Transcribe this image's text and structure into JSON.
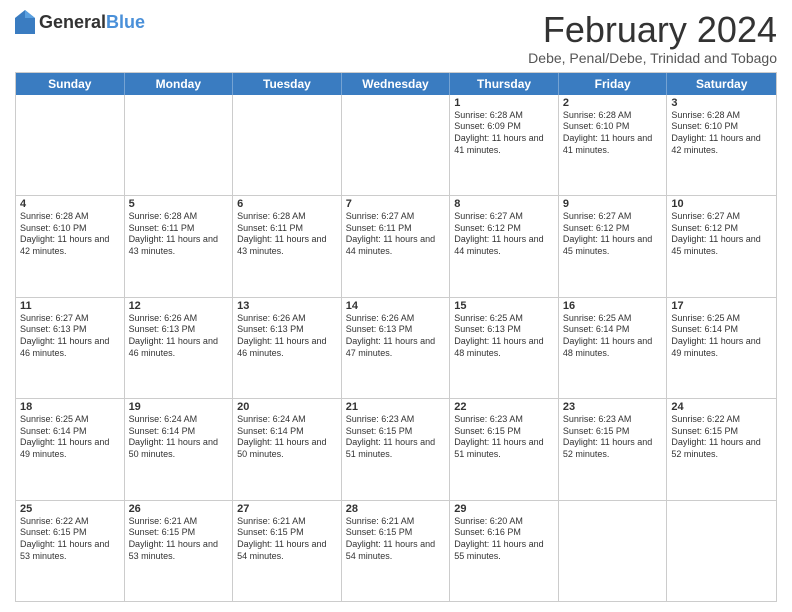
{
  "header": {
    "logo": {
      "general": "General",
      "blue": "Blue"
    },
    "title": "February 2024",
    "subtitle": "Debe, Penal/Debe, Trinidad and Tobago"
  },
  "calendar": {
    "days_of_week": [
      "Sunday",
      "Monday",
      "Tuesday",
      "Wednesday",
      "Thursday",
      "Friday",
      "Saturday"
    ],
    "weeks": [
      [
        {
          "day": "",
          "info": ""
        },
        {
          "day": "",
          "info": ""
        },
        {
          "day": "",
          "info": ""
        },
        {
          "day": "",
          "info": ""
        },
        {
          "day": "1",
          "info": "Sunrise: 6:28 AM\nSunset: 6:09 PM\nDaylight: 11 hours and 41 minutes."
        },
        {
          "day": "2",
          "info": "Sunrise: 6:28 AM\nSunset: 6:10 PM\nDaylight: 11 hours and 41 minutes."
        },
        {
          "day": "3",
          "info": "Sunrise: 6:28 AM\nSunset: 6:10 PM\nDaylight: 11 hours and 42 minutes."
        }
      ],
      [
        {
          "day": "4",
          "info": "Sunrise: 6:28 AM\nSunset: 6:10 PM\nDaylight: 11 hours and 42 minutes."
        },
        {
          "day": "5",
          "info": "Sunrise: 6:28 AM\nSunset: 6:11 PM\nDaylight: 11 hours and 43 minutes."
        },
        {
          "day": "6",
          "info": "Sunrise: 6:28 AM\nSunset: 6:11 PM\nDaylight: 11 hours and 43 minutes."
        },
        {
          "day": "7",
          "info": "Sunrise: 6:27 AM\nSunset: 6:11 PM\nDaylight: 11 hours and 44 minutes."
        },
        {
          "day": "8",
          "info": "Sunrise: 6:27 AM\nSunset: 6:12 PM\nDaylight: 11 hours and 44 minutes."
        },
        {
          "day": "9",
          "info": "Sunrise: 6:27 AM\nSunset: 6:12 PM\nDaylight: 11 hours and 45 minutes."
        },
        {
          "day": "10",
          "info": "Sunrise: 6:27 AM\nSunset: 6:12 PM\nDaylight: 11 hours and 45 minutes."
        }
      ],
      [
        {
          "day": "11",
          "info": "Sunrise: 6:27 AM\nSunset: 6:13 PM\nDaylight: 11 hours and 46 minutes."
        },
        {
          "day": "12",
          "info": "Sunrise: 6:26 AM\nSunset: 6:13 PM\nDaylight: 11 hours and 46 minutes."
        },
        {
          "day": "13",
          "info": "Sunrise: 6:26 AM\nSunset: 6:13 PM\nDaylight: 11 hours and 46 minutes."
        },
        {
          "day": "14",
          "info": "Sunrise: 6:26 AM\nSunset: 6:13 PM\nDaylight: 11 hours and 47 minutes."
        },
        {
          "day": "15",
          "info": "Sunrise: 6:25 AM\nSunset: 6:13 PM\nDaylight: 11 hours and 48 minutes."
        },
        {
          "day": "16",
          "info": "Sunrise: 6:25 AM\nSunset: 6:14 PM\nDaylight: 11 hours and 48 minutes."
        },
        {
          "day": "17",
          "info": "Sunrise: 6:25 AM\nSunset: 6:14 PM\nDaylight: 11 hours and 49 minutes."
        }
      ],
      [
        {
          "day": "18",
          "info": "Sunrise: 6:25 AM\nSunset: 6:14 PM\nDaylight: 11 hours and 49 minutes."
        },
        {
          "day": "19",
          "info": "Sunrise: 6:24 AM\nSunset: 6:14 PM\nDaylight: 11 hours and 50 minutes."
        },
        {
          "day": "20",
          "info": "Sunrise: 6:24 AM\nSunset: 6:14 PM\nDaylight: 11 hours and 50 minutes."
        },
        {
          "day": "21",
          "info": "Sunrise: 6:23 AM\nSunset: 6:15 PM\nDaylight: 11 hours and 51 minutes."
        },
        {
          "day": "22",
          "info": "Sunrise: 6:23 AM\nSunset: 6:15 PM\nDaylight: 11 hours and 51 minutes."
        },
        {
          "day": "23",
          "info": "Sunrise: 6:23 AM\nSunset: 6:15 PM\nDaylight: 11 hours and 52 minutes."
        },
        {
          "day": "24",
          "info": "Sunrise: 6:22 AM\nSunset: 6:15 PM\nDaylight: 11 hours and 52 minutes."
        }
      ],
      [
        {
          "day": "25",
          "info": "Sunrise: 6:22 AM\nSunset: 6:15 PM\nDaylight: 11 hours and 53 minutes."
        },
        {
          "day": "26",
          "info": "Sunrise: 6:21 AM\nSunset: 6:15 PM\nDaylight: 11 hours and 53 minutes."
        },
        {
          "day": "27",
          "info": "Sunrise: 6:21 AM\nSunset: 6:15 PM\nDaylight: 11 hours and 54 minutes."
        },
        {
          "day": "28",
          "info": "Sunrise: 6:21 AM\nSunset: 6:15 PM\nDaylight: 11 hours and 54 minutes."
        },
        {
          "day": "29",
          "info": "Sunrise: 6:20 AM\nSunset: 6:16 PM\nDaylight: 11 hours and 55 minutes."
        },
        {
          "day": "",
          "info": ""
        },
        {
          "day": "",
          "info": ""
        }
      ]
    ]
  }
}
